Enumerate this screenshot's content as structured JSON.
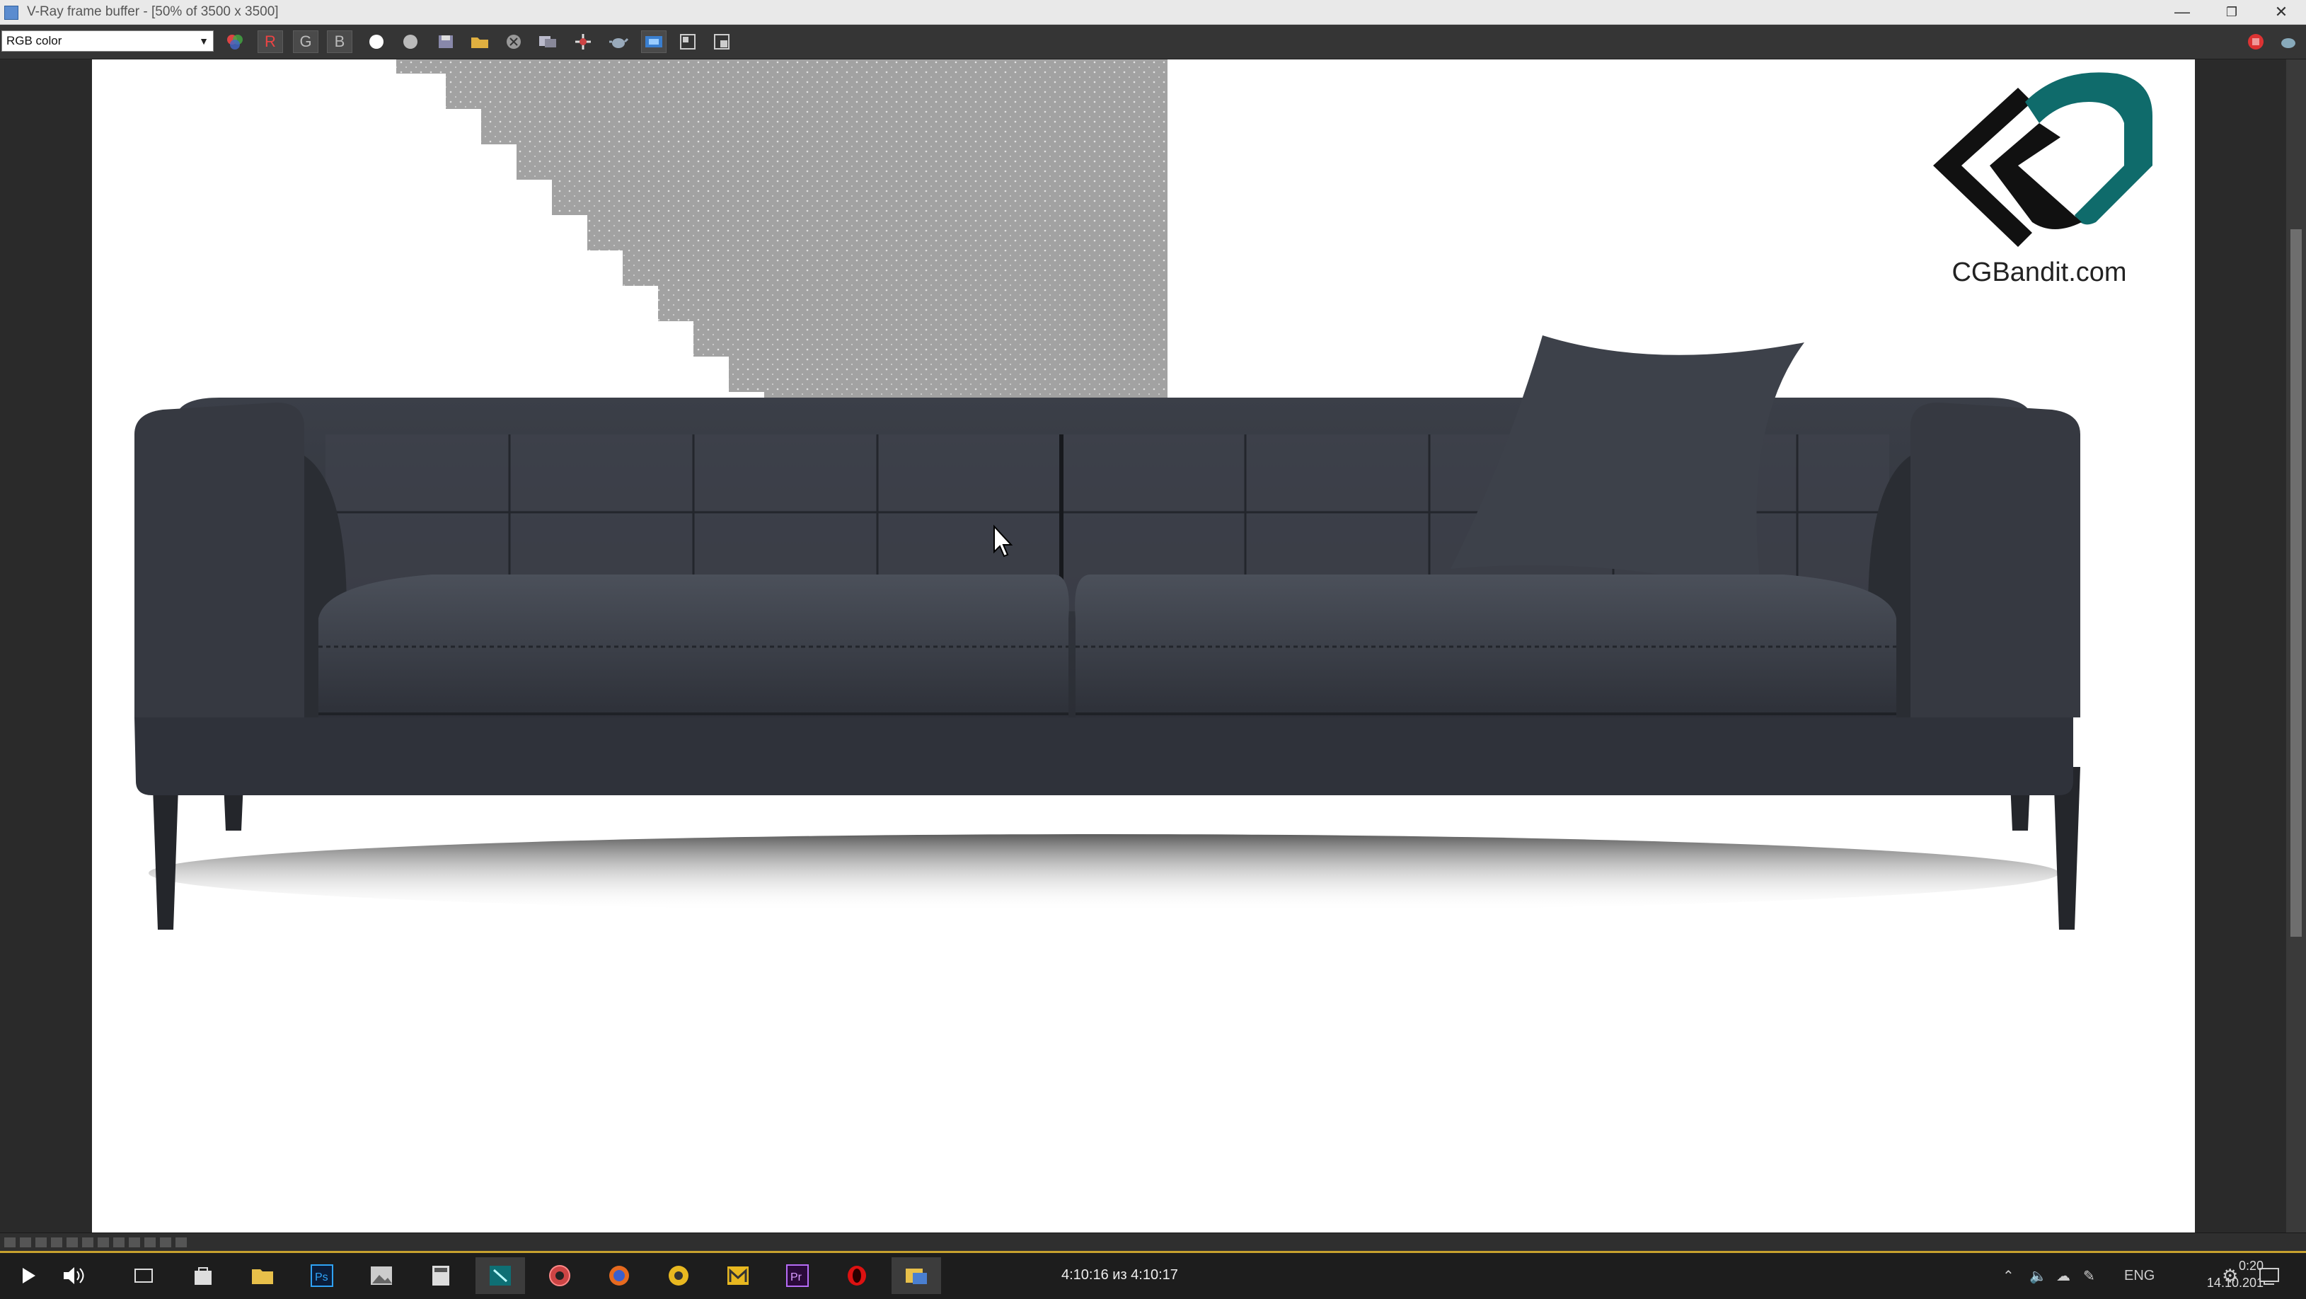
{
  "window": {
    "title": "V-Ray frame buffer - [50% of 3500 x 3500]",
    "minimize_label": "—",
    "restore_label": "❐",
    "close_label": "✕"
  },
  "toolbar": {
    "channel_value": "RGB color",
    "red_label": "R",
    "green_label": "G",
    "blue_label": "B"
  },
  "logo": {
    "text": "CGBandit.com",
    "colors": {
      "dark": "#111111",
      "teal": "#0f6b6b"
    }
  },
  "taskbar": {
    "time_position": "4:10:16 из 4:10:17",
    "language": "ENG",
    "clock_time": "0:20",
    "clock_date": "14.10.201"
  },
  "colors": {
    "accent_strip": "#c7a12e",
    "sofa": "#3b3f47"
  }
}
